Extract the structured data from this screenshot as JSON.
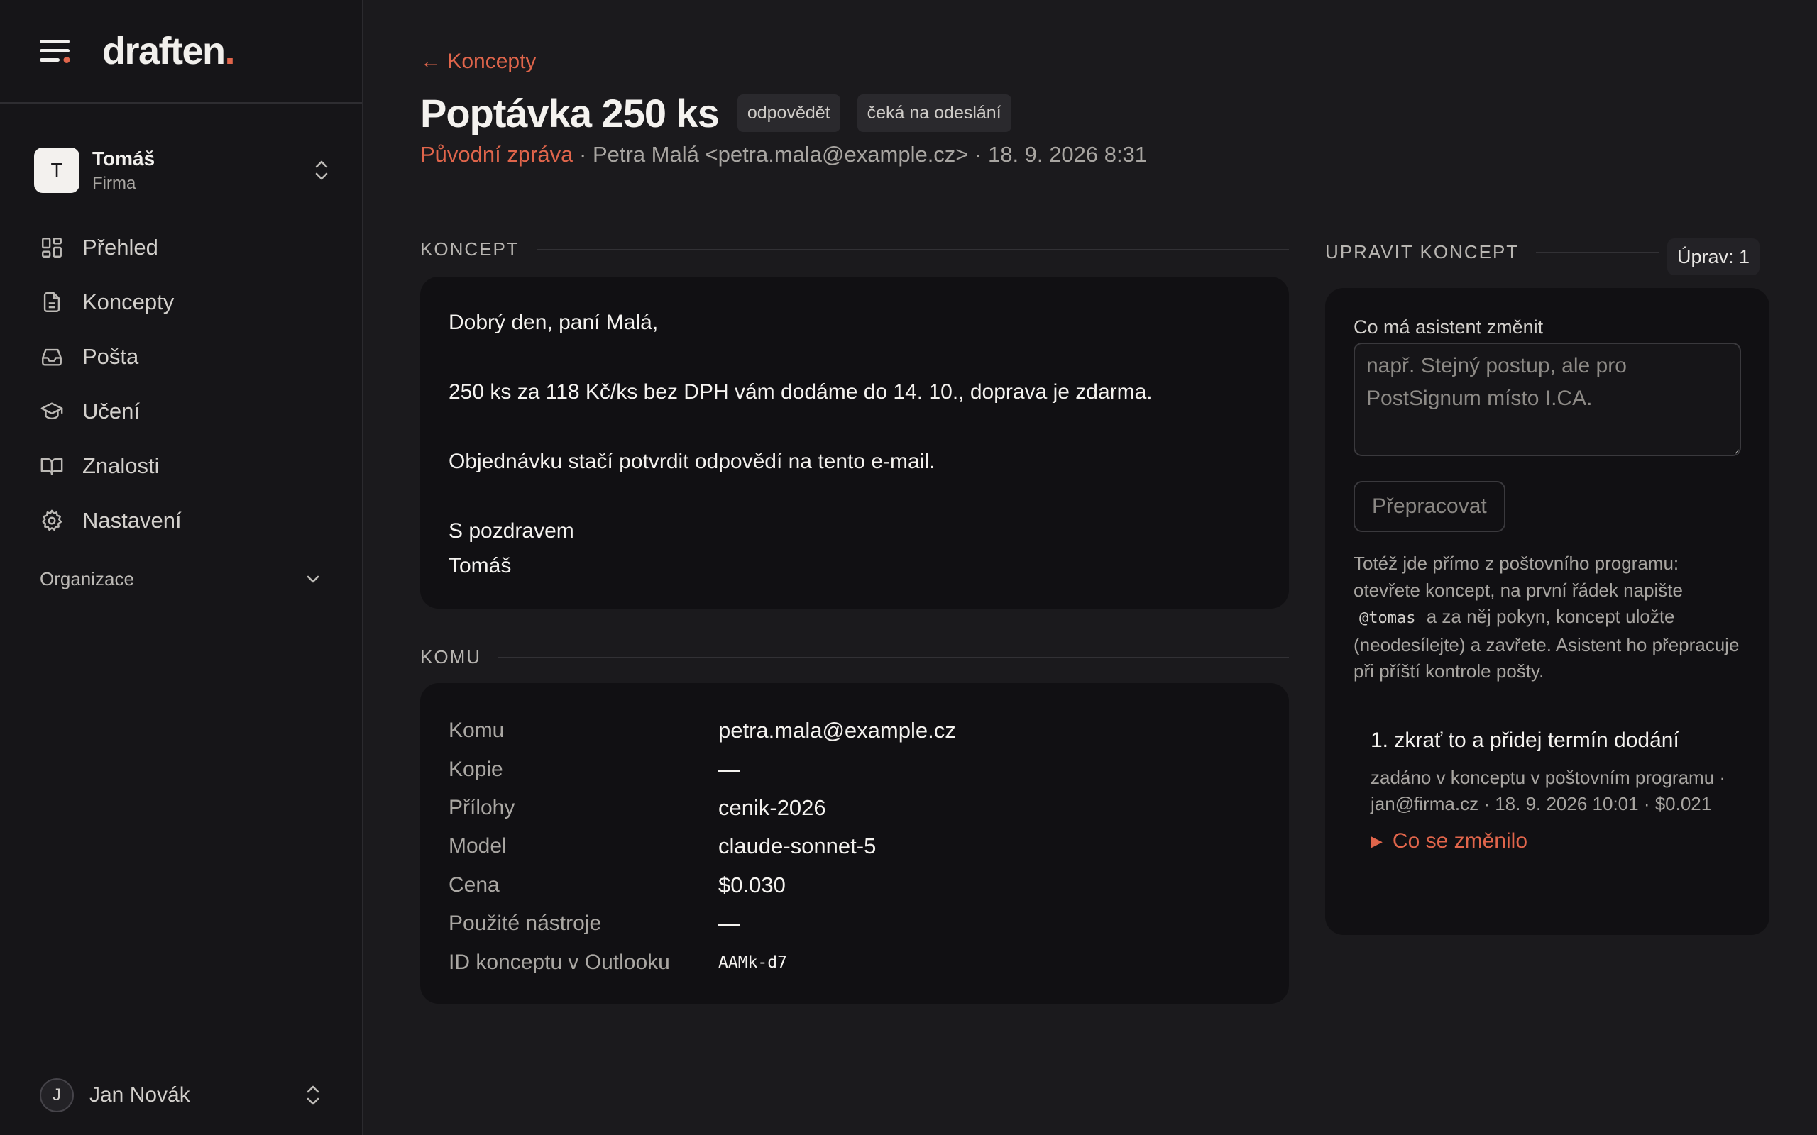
{
  "brand": {
    "name": "draften",
    "dot": "."
  },
  "workspace": {
    "initial": "T",
    "name": "Tomáš",
    "sub": "Firma"
  },
  "nav": [
    {
      "label": "Přehled",
      "icon": "dashboard-icon"
    },
    {
      "label": "Koncepty",
      "icon": "document-icon"
    },
    {
      "label": "Pošta",
      "icon": "inbox-icon"
    },
    {
      "label": "Učení",
      "icon": "graduation-cap-icon"
    },
    {
      "label": "Znalosti",
      "icon": "book-icon"
    },
    {
      "label": "Nastavení",
      "icon": "gear-icon"
    }
  ],
  "org_label": "Organizace",
  "user": {
    "initial": "J",
    "name": "Jan Novák"
  },
  "header": {
    "back": "← Koncepty",
    "title": "Poptávka 250 ks",
    "badges": [
      "odpovědět",
      "čeká na odeslání"
    ],
    "meta_link": "Původní zpráva",
    "meta_rest": " · Petra Malá <petra.mala@example.cz> · 18. 9. 2026 8:31"
  },
  "draft": {
    "section": "KONCEPT",
    "lines": [
      "Dobrý den, paní Malá,",
      "",
      "250 ks za 118 Kč/ks bez DPH vám dodáme do 14. 10., doprava je zdarma.",
      "",
      "Objednávku stačí potvrdit odpovědí na tento e-mail.",
      "",
      "S pozdravem",
      "Tomáš"
    ]
  },
  "recipients": {
    "section": "KOMU",
    "rows": [
      {
        "k": "Komu",
        "v": "petra.mala@example.cz"
      },
      {
        "k": "Kopie",
        "v": "—"
      },
      {
        "k": "Přílohy",
        "v": "cenik-2026"
      },
      {
        "k": "Model",
        "v": "claude-sonnet-5"
      },
      {
        "k": "Cena",
        "v": "$0.030"
      },
      {
        "k": "Použité nástroje",
        "v": "—"
      },
      {
        "k": "ID konceptu v Outlooku",
        "v": "AAMk-d7"
      }
    ]
  },
  "edit": {
    "section": "UPRAVIT KONCEPT",
    "count": "Úprav: 1",
    "field_label": "Co má asistent změnit",
    "placeholder": "např. Stejný postup, ale pro PostSignum místo I.CA.",
    "button": "Přepracovat",
    "help_before": "Totéž jde přímo z poštovního programu: otevřete koncept, na první řádek napište",
    "help_code": "@tomas",
    "help_after": "a za něj pokyn, koncept uložte (neodesílejte) a zavřete. Asistent ho přepracuje při příští kontrole pošty.",
    "revision_title": "1. zkrať to a přidej termín dodání",
    "revision_meta": "zadáno v konceptu v poštovním programu · jan@firma.cz · 18. 9. 2026 10:01 · $0.021",
    "revision_toggle": "Co se změnilo"
  },
  "colors": {
    "accent": "#e0654b",
    "background": "#1b1a1d",
    "sidebar": "#161518",
    "card": "#111013"
  }
}
